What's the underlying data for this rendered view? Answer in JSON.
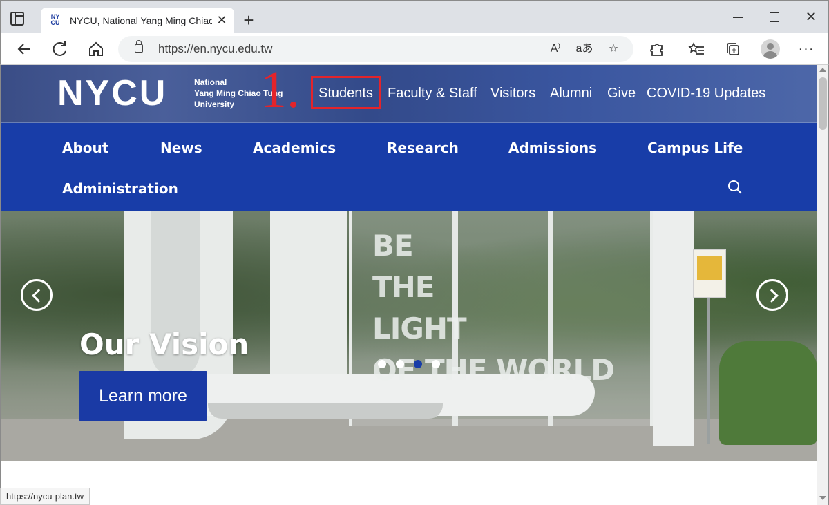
{
  "browser": {
    "tab_title": "NYCU, National Yang Ming Chiao Tung University",
    "tab_favicon_text": "NY CU",
    "url": "https://en.nycu.edu.tw",
    "status_url": "https://nycu-plan.tw",
    "icons": {
      "back": "back-arrow-icon",
      "reload": "reload-icon",
      "home": "home-icon",
      "read_aloud": "read-aloud-icon",
      "translate": "translate-icon",
      "favorite_add": "add-favorite-icon",
      "extensions": "extensions-icon",
      "favorites": "favorites-icon",
      "collections": "collections-icon",
      "profile": "profile-avatar",
      "menu": "more-menu-icon"
    }
  },
  "site": {
    "logo": "NYCU",
    "logo_sub": [
      "National",
      "Yang Ming Chiao Tung",
      "University"
    ],
    "annotation": "1.",
    "util_nav": [
      "Students",
      "Faculty & Staff",
      "Visitors",
      "Alumni",
      "Give",
      "COVID-19 Updates"
    ],
    "main_nav": [
      "About",
      "News",
      "Academics",
      "Research",
      "Admissions",
      "Campus Life",
      "Administration"
    ]
  },
  "hero": {
    "sign_lines": [
      "BE",
      "THE",
      "LIGHT",
      "OF THE WORLD"
    ],
    "title": "Our Vision",
    "button": "Learn more",
    "slide_count": 4,
    "active_slide": 3
  },
  "colors": {
    "nav_blue": "#183da8",
    "button_blue": "#1a3aa5",
    "annotation_red": "#e3242b"
  }
}
